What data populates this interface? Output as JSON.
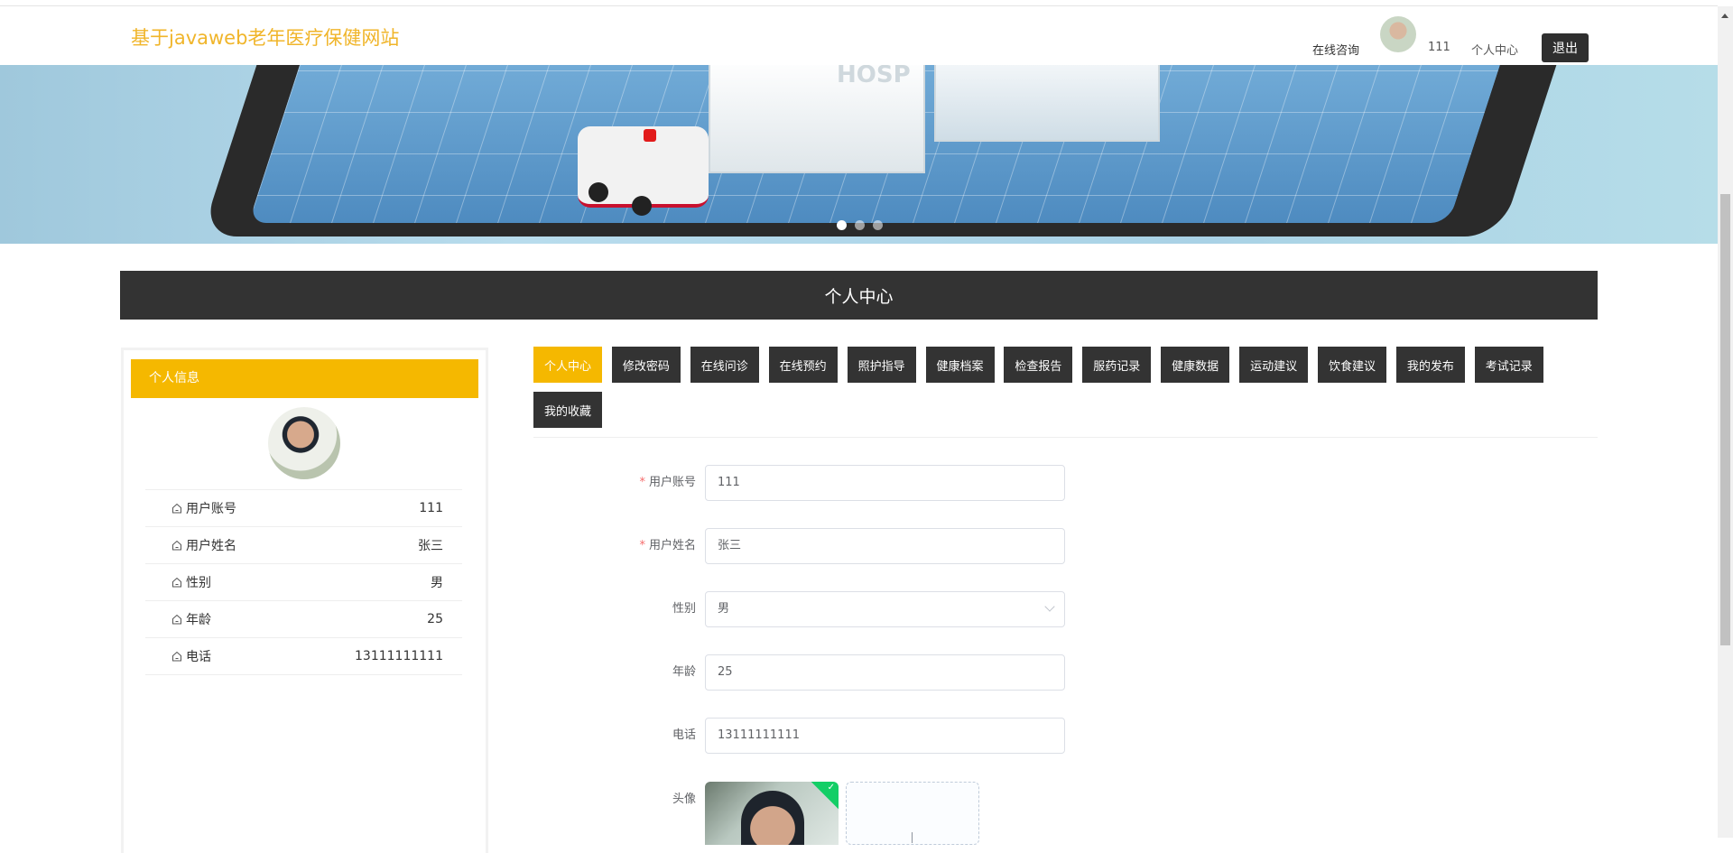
{
  "header": {
    "site_title": "基于javaweb老年医疗保健网站",
    "nav": {
      "consult": "在线咨询",
      "username": "111",
      "personal_center": "个人中心",
      "logout": "退出"
    }
  },
  "banner": {
    "slides": 3,
    "active_slide": 1,
    "sign_text": "HOSP"
  },
  "page_title": "个人中心",
  "sidebar": {
    "heading": "个人信息",
    "rows": [
      {
        "label": "用户账号",
        "value": "111"
      },
      {
        "label": "用户姓名",
        "value": "张三"
      },
      {
        "label": "性别",
        "value": "男"
      },
      {
        "label": "年龄",
        "value": "25"
      },
      {
        "label": "电话",
        "value": "13111111111"
      }
    ]
  },
  "tabs": [
    "个人中心",
    "修改密码",
    "在线问诊",
    "在线预约",
    "照护指导",
    "健康档案",
    "检查报告",
    "服药记录",
    "健康数据",
    "运动建议",
    "饮食建议",
    "我的发布",
    "考试记录",
    "我的收藏"
  ],
  "active_tab": 0,
  "form": {
    "fields": [
      {
        "label": "用户账号",
        "value": "111",
        "required": true
      },
      {
        "label": "用户姓名",
        "value": "张三",
        "required": true
      },
      {
        "label": "性别",
        "value": "男",
        "required": false,
        "type": "select"
      },
      {
        "label": "年龄",
        "value": "25",
        "required": false
      },
      {
        "label": "电话",
        "value": "13111111111",
        "required": false
      }
    ],
    "avatar_label": "头像"
  },
  "colors": {
    "accent": "#f5b800",
    "dark": "#333333",
    "title": "#f0b52a"
  }
}
